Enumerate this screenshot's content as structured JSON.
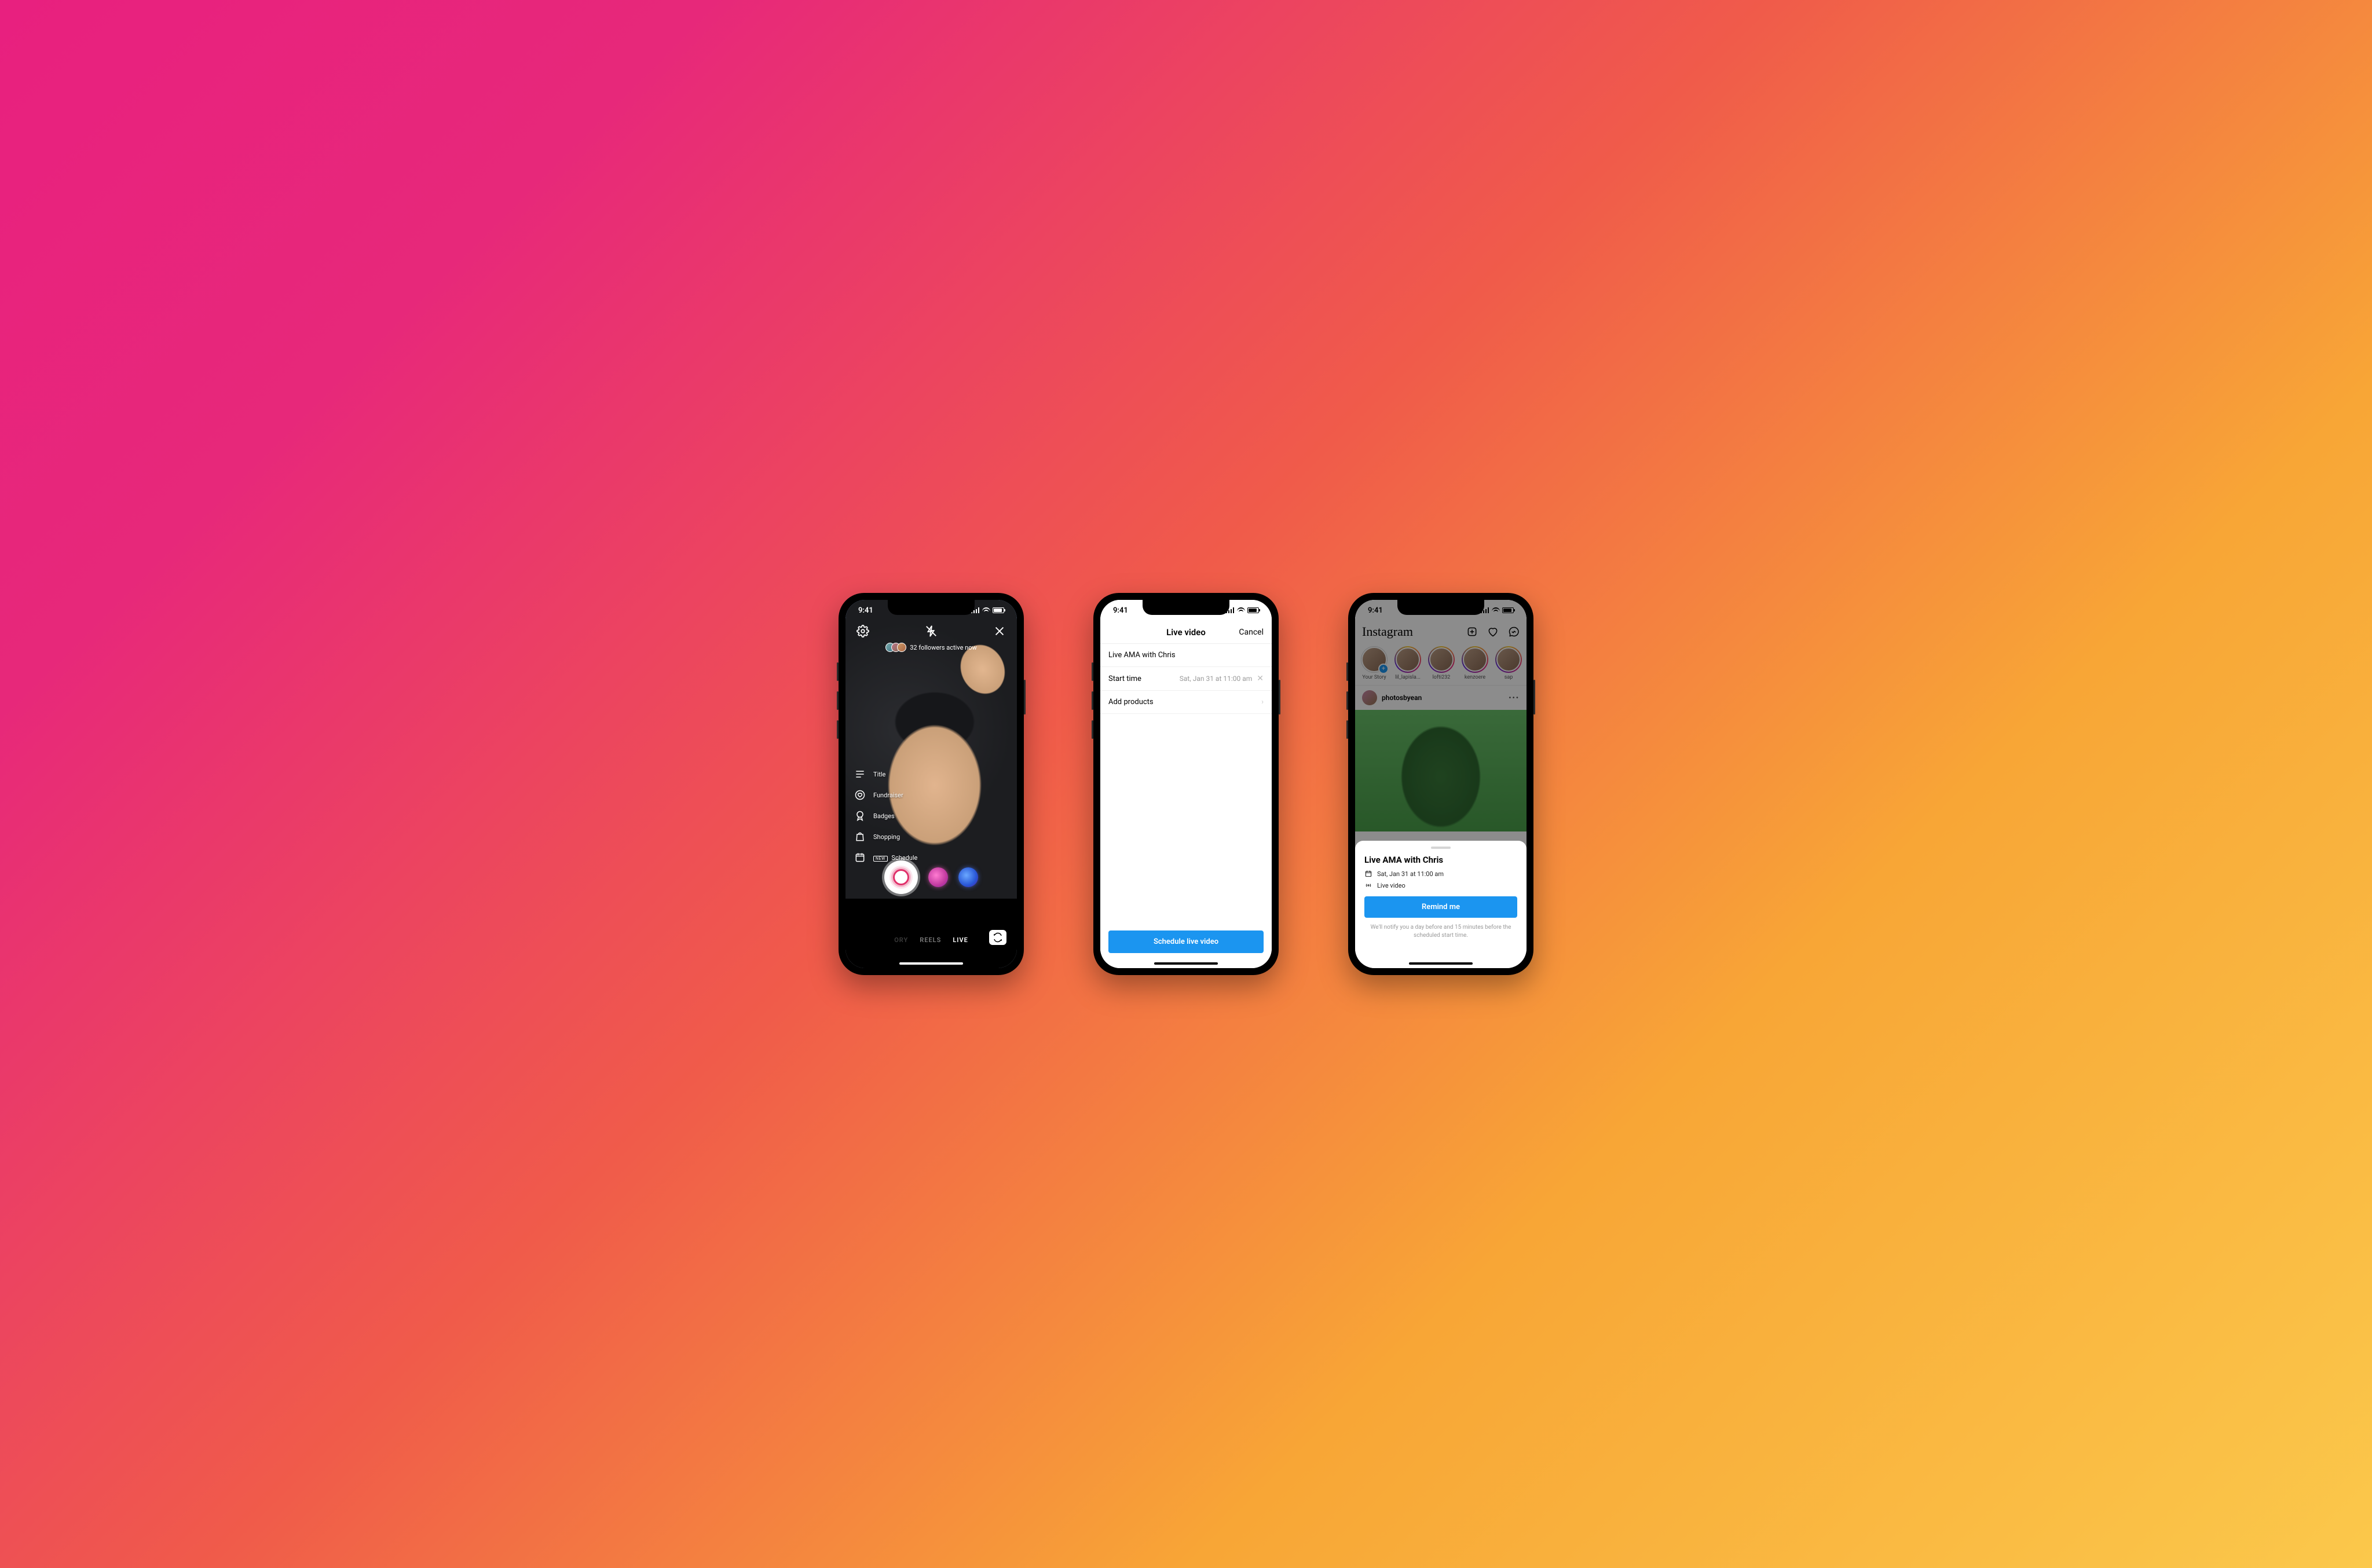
{
  "status": {
    "time": "9:41"
  },
  "phone1": {
    "followers_active": "32 followers active now",
    "options": {
      "title": "Title",
      "fundraiser": "Fundraiser",
      "badges": "Badges",
      "shopping": "Shopping",
      "schedule": "Schedule",
      "schedule_badge": "NEW"
    },
    "modes": {
      "story": "ORY",
      "reels": "REELS",
      "live": "LIVE"
    }
  },
  "phone2": {
    "header": {
      "title": "Live video",
      "cancel": "Cancel"
    },
    "title_value": "Live AMA with Chris",
    "start_time_label": "Start time",
    "start_time_value": "Sat, Jan 31 at 11:00 am",
    "add_products": "Add products",
    "cta": "Schedule live video"
  },
  "phone3": {
    "brand": "Instagram",
    "stories": [
      {
        "label": "Your Story"
      },
      {
        "label": "lil_lapisla..."
      },
      {
        "label": "lofti232"
      },
      {
        "label": "kenzoere"
      },
      {
        "label": "sap"
      }
    ],
    "post_user": "photosbyean",
    "sheet": {
      "title": "Live AMA with Chris",
      "when": "Sat, Jan 31 at 11:00 am",
      "type": "Live video",
      "cta": "Remind me",
      "note": "We'll notify you a day before and 15 minutes before the scheduled start time."
    }
  }
}
